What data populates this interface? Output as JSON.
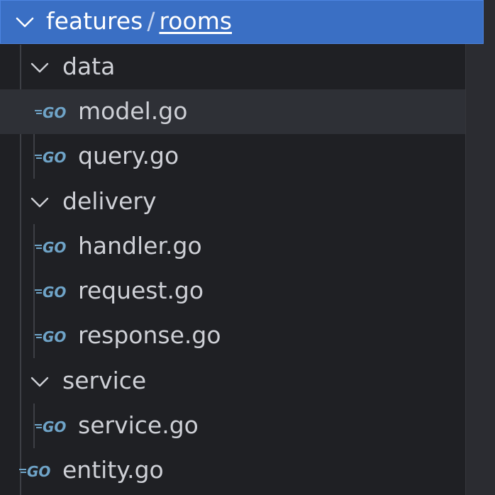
{
  "root": {
    "folder": "features",
    "separator": "/",
    "subfolder": "rooms"
  },
  "tree": {
    "data": {
      "label": "data",
      "files": [
        "model.go",
        "query.go"
      ]
    },
    "delivery": {
      "label": "delivery",
      "files": [
        "handler.go",
        "request.go",
        "response.go"
      ]
    },
    "service": {
      "label": "service",
      "files": [
        "service.go"
      ]
    },
    "root_file": "entity.go"
  },
  "icons": {
    "folder_chevron": "chevron-down-icon",
    "file": "go-file-icon"
  },
  "colors": {
    "background": "#1f2024",
    "root_highlight": "#3a6fc4",
    "selected_row": "#2e3036",
    "text": "#ced0d6",
    "go_icon": "#6fa4c8"
  }
}
